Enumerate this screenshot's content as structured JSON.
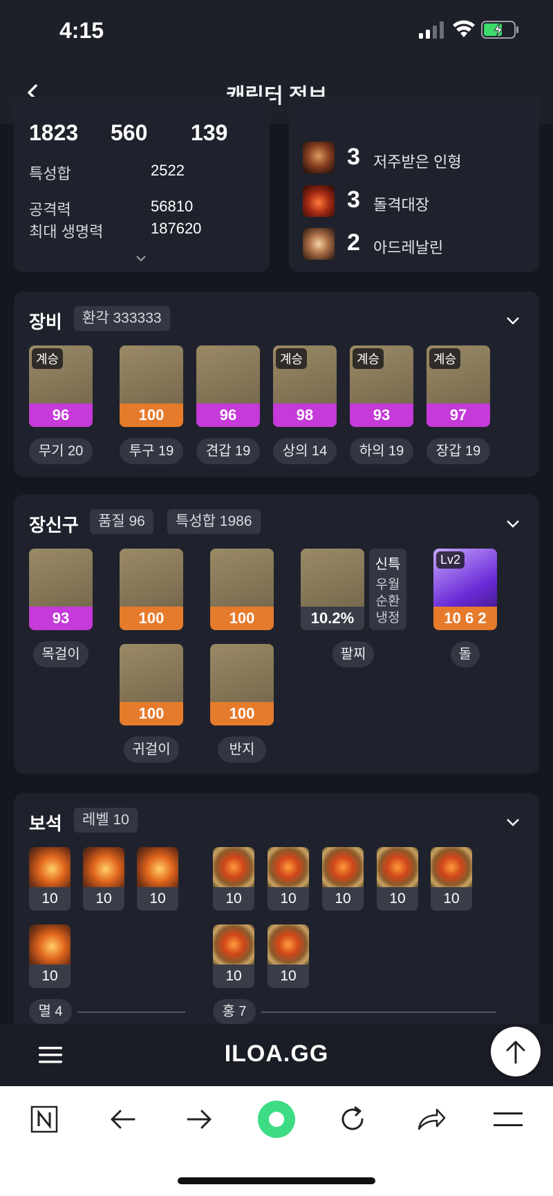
{
  "status": {
    "time": "4:15"
  },
  "header": {
    "title": "캐릭터 정보"
  },
  "stats": {
    "top_numbers": [
      "1823",
      "560",
      "139"
    ],
    "rows": [
      {
        "label": "특성합",
        "value": "2522"
      },
      {
        "label": "공격력",
        "value": "56810"
      },
      {
        "label": "최대 생명력",
        "value": "187620"
      }
    ]
  },
  "engravings": [
    {
      "level": "3",
      "name": "저주받은 인형",
      "icon": "cursed-doll-icon"
    },
    {
      "level": "3",
      "name": "돌격대장",
      "icon": "vanguard-icon"
    },
    {
      "level": "2",
      "name": "아드레날린",
      "icon": "adrenaline-icon"
    }
  ],
  "equipment": {
    "title": "장비",
    "chip": "환각 333333",
    "items": [
      {
        "badge": "계승",
        "quality": "96",
        "label": "무기 20",
        "bar": "purple"
      },
      {
        "badge": "",
        "quality": "100",
        "label": "투구 19",
        "bar": "orange"
      },
      {
        "badge": "",
        "quality": "96",
        "label": "견갑 19",
        "bar": "purple"
      },
      {
        "badge": "계승",
        "quality": "98",
        "label": "상의 14",
        "bar": "purple"
      },
      {
        "badge": "계승",
        "quality": "93",
        "label": "하의 19",
        "bar": "purple"
      },
      {
        "badge": "계승",
        "quality": "97",
        "label": "장갑 19",
        "bar": "purple"
      }
    ]
  },
  "accessories": {
    "title": "장신구",
    "chips": [
      "품질 96",
      "특성합 1986"
    ],
    "necklace": {
      "quality": "93",
      "label": "목걸이"
    },
    "earrings": {
      "qualities": [
        "100",
        "100"
      ],
      "label": "귀걸이"
    },
    "rings": {
      "qualities": [
        "100",
        "100"
      ],
      "label": "반지"
    },
    "bracelet": {
      "value": "10.2%",
      "label": "팔찌",
      "effects": [
        "신특",
        "우월",
        "순환",
        "냉정"
      ]
    },
    "stone": {
      "badge": "Lv2",
      "value": "10 6 2",
      "label": "돌"
    }
  },
  "gems": {
    "title": "보석",
    "chip": "레벨 10",
    "annihilation": {
      "levels": [
        "10",
        "10",
        "10",
        "10"
      ],
      "label": "멸 4"
    },
    "crimson": {
      "levels": [
        "10",
        "10",
        "10",
        "10",
        "10",
        "10",
        "10"
      ],
      "label": "홍 7"
    }
  },
  "bottom": {
    "brand": "ILOA.GG"
  },
  "colors": {
    "purple": "#c53ad8",
    "orange": "#e67b2c",
    "accent_green": "#3ddc84"
  }
}
